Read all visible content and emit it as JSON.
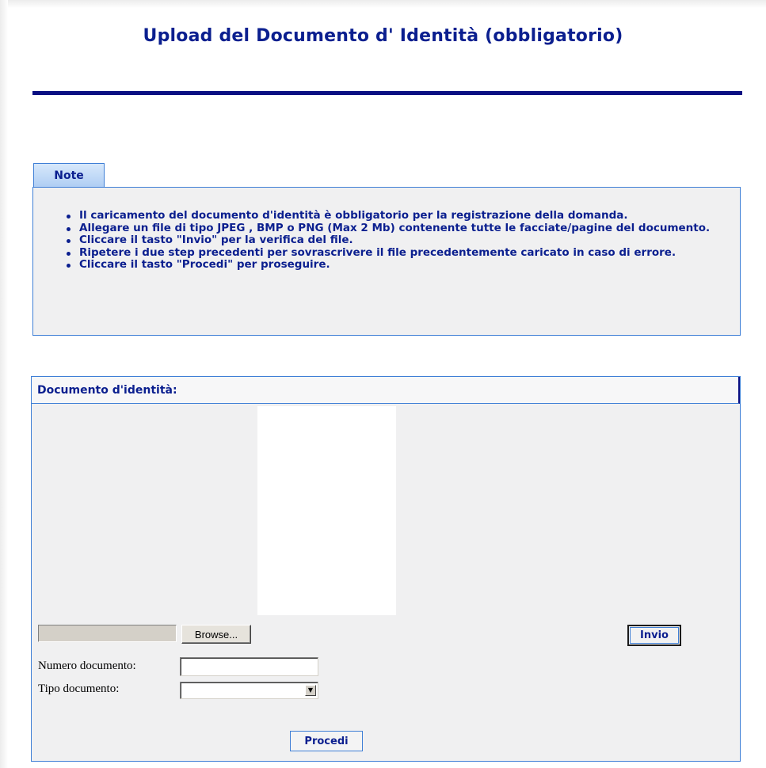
{
  "page": {
    "title": "Upload del Documento d' Identità (obbligatorio)"
  },
  "notes": {
    "tab_label": "Note",
    "items": [
      "Il caricamento del documento d'identità è obbligatorio per la registrazione della domanda.",
      "Allegare un file di tipo JPEG , BMP o PNG (Max 2 Mb) contenente tutte le facciate/pagine del documento.",
      "Cliccare il tasto \"Invio\" per la verifica del file.",
      "Ripetere i due step precedenti per sovrascrivere il file precedentemente caricato in caso di errore.",
      "Cliccare il tasto \"Procedi\" per proseguire."
    ]
  },
  "document": {
    "header": "Documento d'identità:",
    "browse_label": "Browse...",
    "invio_label": "Invio",
    "numero_label": "Numero documento:",
    "numero_value": "",
    "tipo_label": "Tipo documento:",
    "tipo_selected": "",
    "procedi_label": "Procedi"
  },
  "colors": {
    "accent": "#0b1f8f",
    "rule": "#0a0f82",
    "border": "#3f7fd6",
    "panel_bg": "#f0f0f1"
  },
  "icons": {
    "dropdown": "chevron-down-icon",
    "bullet": "bullet-icon"
  }
}
